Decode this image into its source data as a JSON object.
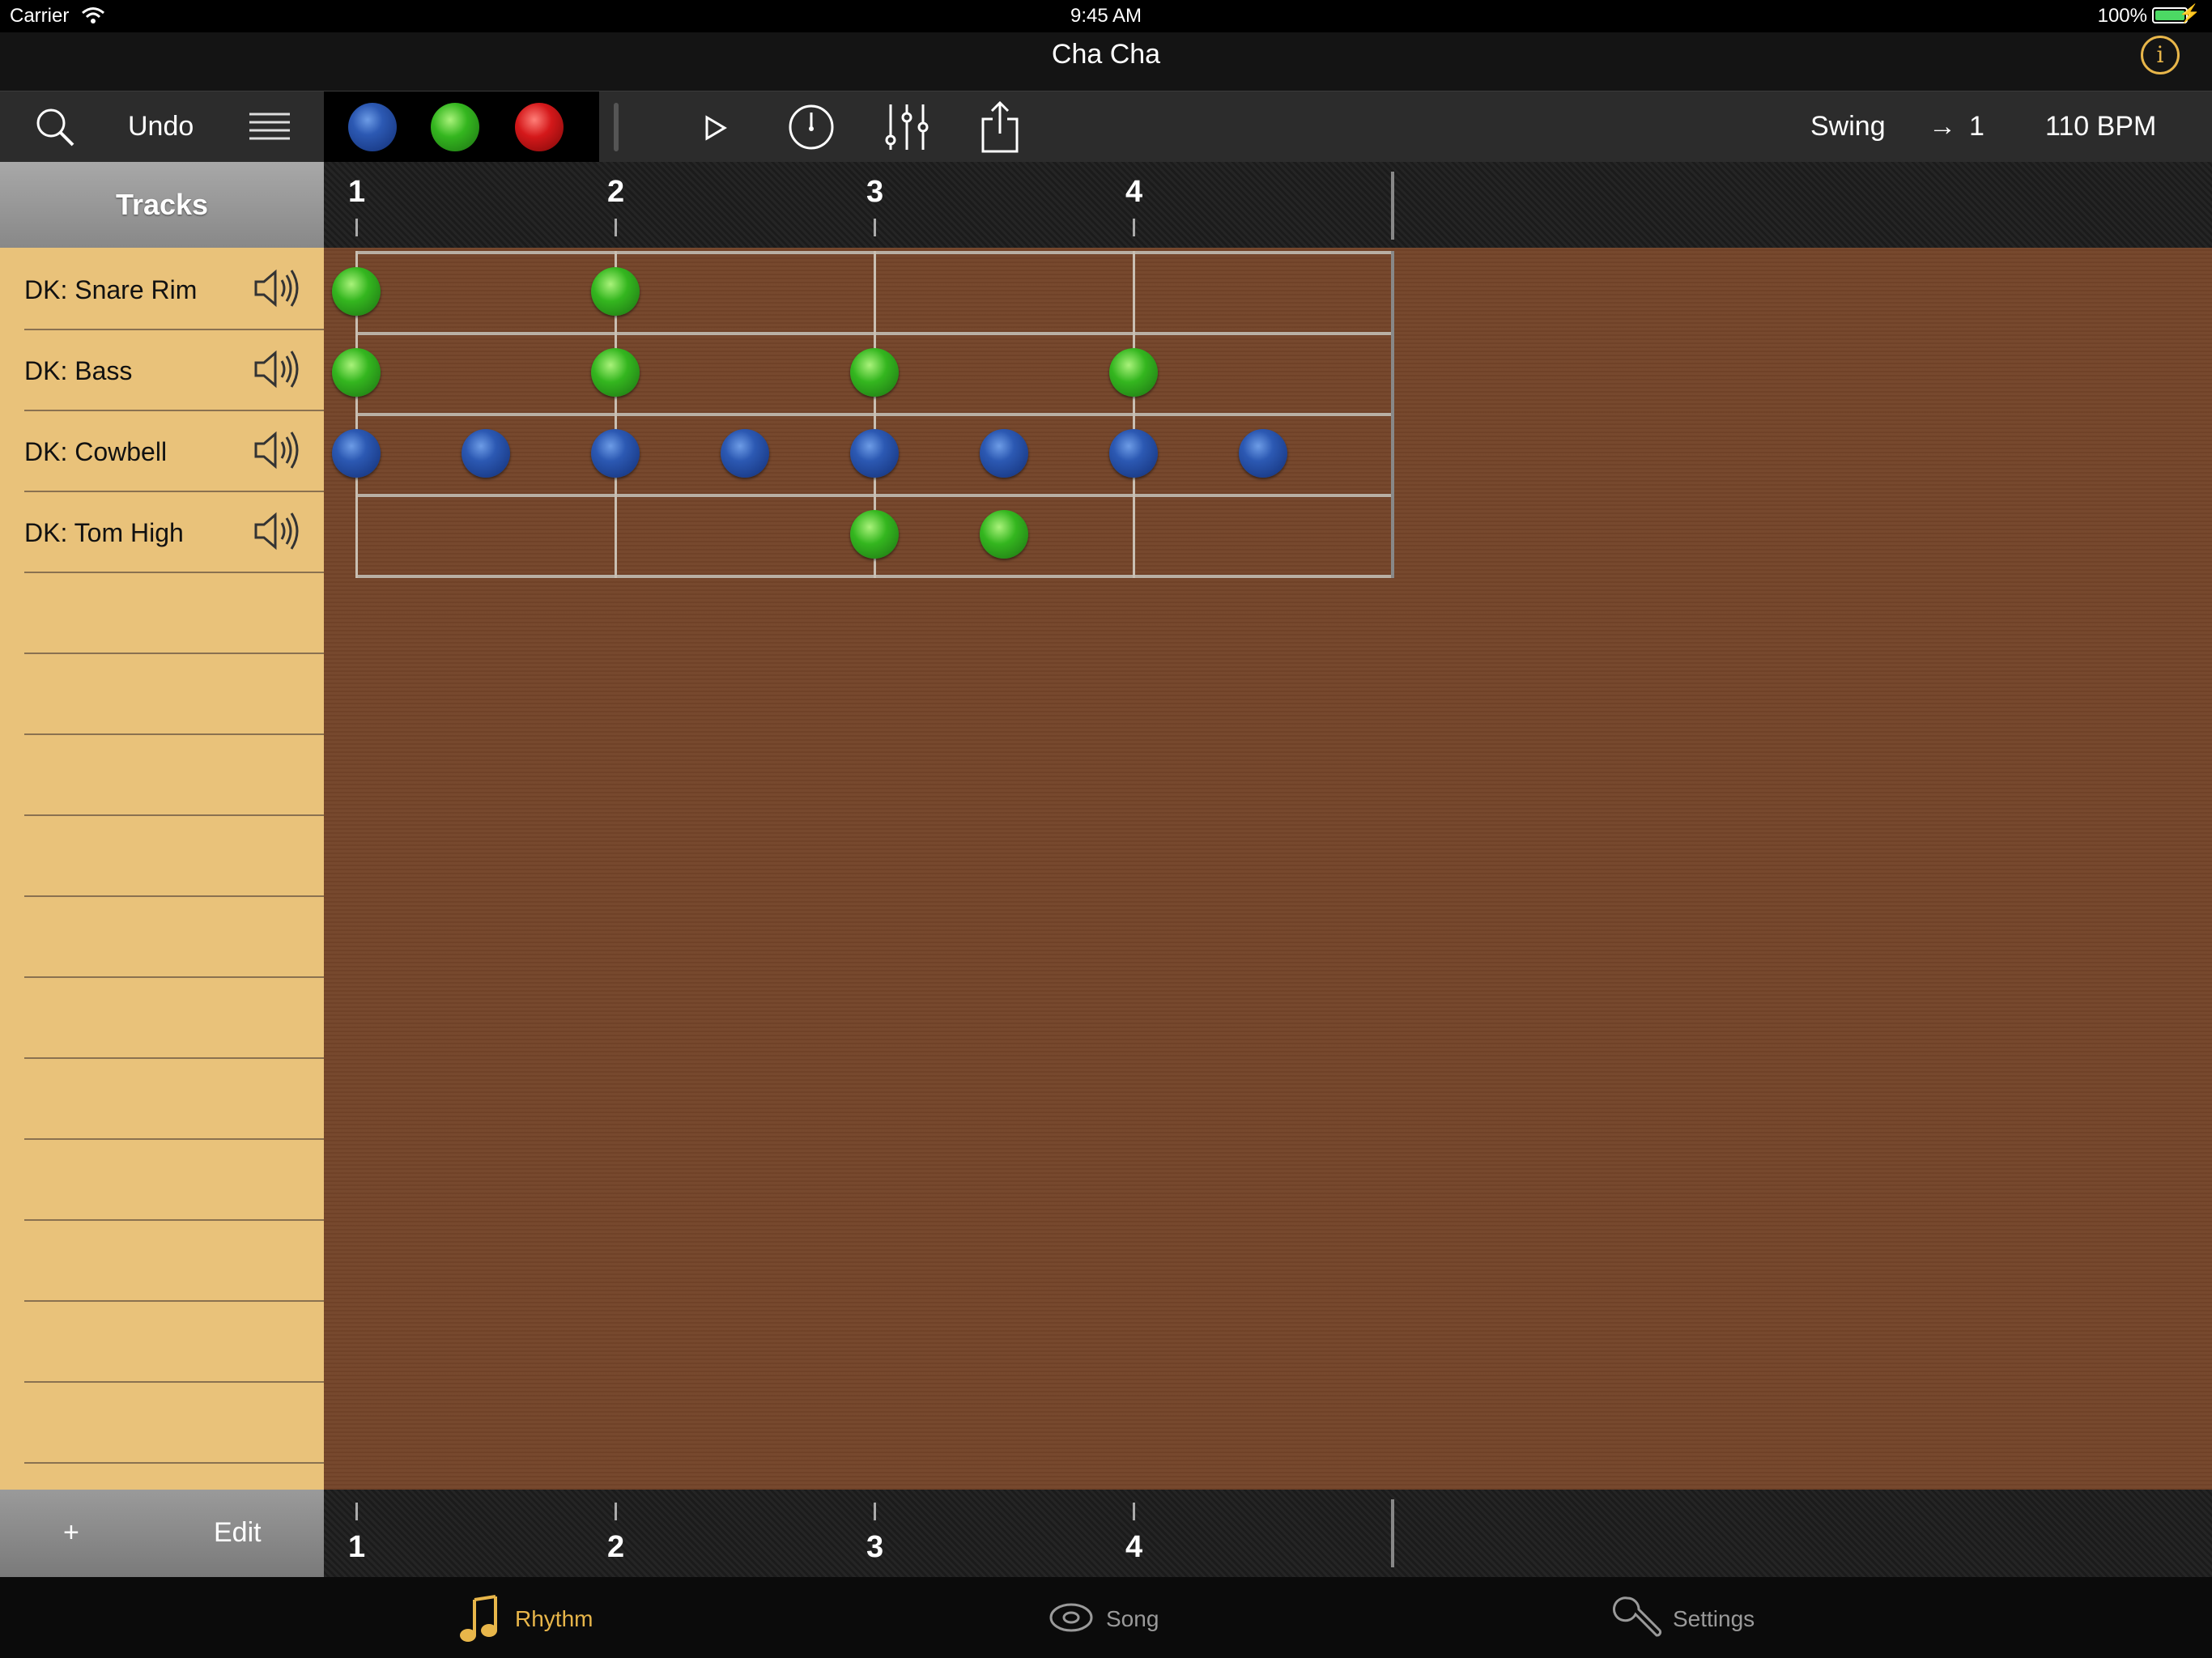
{
  "status": {
    "carrier": "Carrier",
    "time": "9:45 AM",
    "battery": "100%"
  },
  "title": "Cha Cha",
  "toolbar": {
    "search_icon": "search-icon",
    "undo_label": "Undo",
    "list_icon": "list-icon",
    "palette": [
      "#2c59b3",
      "#34b61f",
      "#d4181a"
    ],
    "swing_label": "Swing",
    "arrow_value": "1",
    "tempo": "110 BPM"
  },
  "sidebar": {
    "header": "Tracks",
    "tracks": [
      {
        "name": "DK: Snare Rim"
      },
      {
        "name": "DK: Bass"
      },
      {
        "name": "DK: Cowbell"
      },
      {
        "name": "DK: Tom High"
      }
    ],
    "add_label": "+",
    "edit_label": "Edit"
  },
  "grid": {
    "beats": [
      "1",
      "2",
      "3",
      "4"
    ],
    "steps_per_beat": 2,
    "rows": [
      {
        "track": "DK: Snare Rim",
        "notes": [
          {
            "step": 0,
            "color": "green"
          },
          {
            "step": 2,
            "color": "green"
          }
        ]
      },
      {
        "track": "DK: Bass",
        "notes": [
          {
            "step": 0,
            "color": "green"
          },
          {
            "step": 2,
            "color": "green"
          },
          {
            "step": 4,
            "color": "green"
          },
          {
            "step": 6,
            "color": "green"
          }
        ]
      },
      {
        "track": "DK: Cowbell",
        "notes": [
          {
            "step": 0,
            "color": "blue"
          },
          {
            "step": 1,
            "color": "blue"
          },
          {
            "step": 2,
            "color": "blue"
          },
          {
            "step": 3,
            "color": "blue"
          },
          {
            "step": 4,
            "color": "blue"
          },
          {
            "step": 5,
            "color": "blue"
          },
          {
            "step": 6,
            "color": "blue"
          },
          {
            "step": 7,
            "color": "blue"
          }
        ]
      },
      {
        "track": "DK: Tom High",
        "notes": [
          {
            "step": 4,
            "color": "green"
          },
          {
            "step": 5,
            "color": "green"
          }
        ]
      }
    ]
  },
  "tabbar": {
    "tabs": [
      {
        "label": "Rhythm",
        "icon": "music-note-icon",
        "active": true
      },
      {
        "label": "Song",
        "icon": "record-icon",
        "active": false
      },
      {
        "label": "Settings",
        "icon": "wrench-icon",
        "active": false
      }
    ]
  },
  "colors": {
    "accent": "#e8b64a",
    "sidebar": "#e9c27a",
    "grid_bg": "#74452a"
  }
}
